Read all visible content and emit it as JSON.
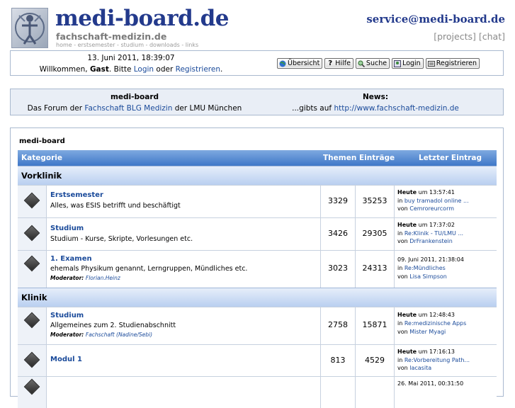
{
  "header": {
    "title": "medi-board.de",
    "subtitle": "fachschaft-medizin.de",
    "nav": "home - erstsemester - studium - downloads - links",
    "email": "service@medi-board.de",
    "projects_label": "projects",
    "chat_label": "chat"
  },
  "welcome": {
    "date": "13. Juni 2011, 18:39:07",
    "greet_prefix": "Willkommen, ",
    "guest": "Gast",
    "greet_mid": ". Bitte ",
    "login_link": "Login",
    "or": " oder ",
    "register_link": "Registrieren",
    "end": "."
  },
  "toolbar": {
    "overview": "Übersicht",
    "help": "Hilfe",
    "search": "Suche",
    "login": "Login",
    "register": "Registrieren"
  },
  "info": {
    "left_heading": "medi-board",
    "left_prefix": "Das Forum der ",
    "left_link": "Fachschaft BLG Medizin",
    "left_suffix": " der LMU München",
    "right_heading": "News:",
    "right_prefix": "...gibts auf ",
    "right_link": "http://www.fachschaft-medizin.de"
  },
  "forum": {
    "title": "medi-board",
    "columns": {
      "category": "Kategorie",
      "threads": "Themen",
      "entries": "Einträge",
      "last": "Letzter Eintrag"
    },
    "sections": [
      {
        "name": "Vorklinik",
        "boards": [
          {
            "name": "Erstsemester",
            "desc": "Alles, was ESIS betrifft und beschäftigt",
            "moderator_label": "",
            "moderator": "",
            "threads": "3329",
            "entries": "35253",
            "last_date_bold": "Heute",
            "last_time": " um 13:57:41",
            "last_in": "in ",
            "last_topic": "buy tramadol online ...",
            "last_by": "von ",
            "last_user": "Cemroreurcorm"
          },
          {
            "name": "Studium",
            "desc": "Studium - Kurse, Skripte, Vorlesungen etc.",
            "moderator_label": "",
            "moderator": "",
            "threads": "3426",
            "entries": "29305",
            "last_date_bold": "Heute",
            "last_time": " um 17:37:02",
            "last_in": "in ",
            "last_topic": "Re:Klinik - TU/LMU ...",
            "last_by": "von ",
            "last_user": "DrFrankenstein"
          },
          {
            "name": "1. Examen",
            "desc": "ehemals Physikum genannt, Lerngruppen, Mündliches etc.",
            "moderator_label": "Moderator: ",
            "moderator": "Florian.Heinz",
            "threads": "3023",
            "entries": "24313",
            "last_date_bold": "",
            "last_time": "09. Juni 2011, 21:38:04",
            "last_in": "in ",
            "last_topic": "Re:Mündliches",
            "last_by": "von ",
            "last_user": "Lisa Simpson"
          }
        ]
      },
      {
        "name": "Klinik",
        "boards": [
          {
            "name": "Studium",
            "desc": "Allgemeines zum 2. Studienabschnitt",
            "moderator_label": "Moderator: ",
            "moderator": "Fachschaft (Nadine/Sebi)",
            "threads": "2758",
            "entries": "15871",
            "last_date_bold": "Heute",
            "last_time": " um 12:48:43",
            "last_in": "in ",
            "last_topic": "Re:medizinische Apps",
            "last_by": "von ",
            "last_user": "Mister Myagi"
          },
          {
            "name": "Modul 1",
            "desc": "",
            "moderator_label": "",
            "moderator": "",
            "threads": "813",
            "entries": "4529",
            "last_date_bold": "Heute",
            "last_time": " um 17:16:13",
            "last_in": "in ",
            "last_topic": "Re:Vorbereitung Path...",
            "last_by": "von ",
            "last_user": "lacasita"
          },
          {
            "name": "",
            "desc": "",
            "moderator_label": "",
            "moderator": "",
            "threads": "",
            "entries": "",
            "last_date_bold": "",
            "last_time": "26. Mai 2011, 00:31:50",
            "last_in": "",
            "last_topic": "",
            "last_by": "",
            "last_user": ""
          }
        ]
      }
    ]
  }
}
